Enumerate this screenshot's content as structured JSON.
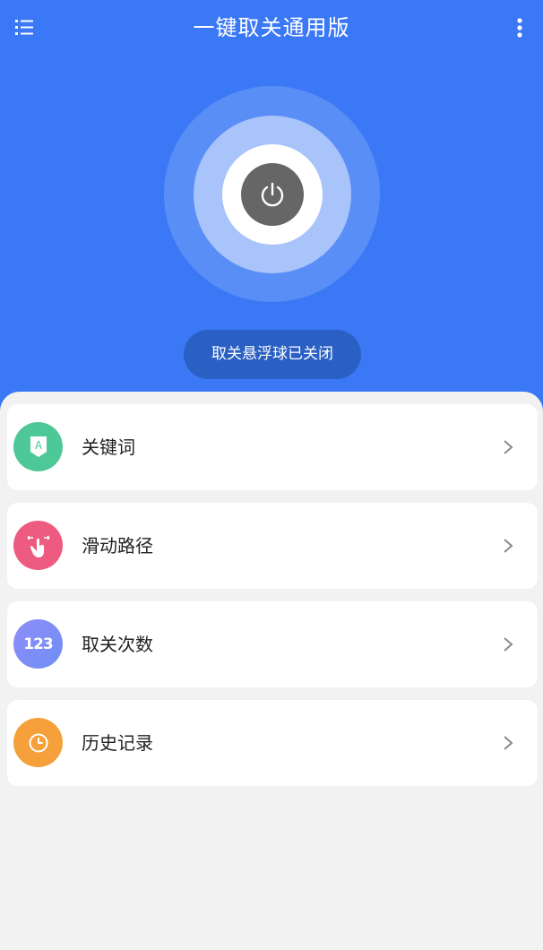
{
  "header": {
    "title": "一键取关通用版",
    "menu_icon": "list-menu-icon",
    "more_icon": "more-vertical-icon"
  },
  "power": {
    "icon": "power-icon",
    "status_text": "取关悬浮球已关闭"
  },
  "colors": {
    "primary": "#3a78f6",
    "pill": "#2a5fc3",
    "power_button": "#666666",
    "background": "#f2f2f2"
  },
  "menu": {
    "items": [
      {
        "label": "关键词",
        "icon": "keyword-tag-icon",
        "icon_text": "A",
        "color": "#4fc897"
      },
      {
        "label": "滑动路径",
        "icon": "swipe-gesture-icon",
        "color": "#ee5b80"
      },
      {
        "label": "取关次数",
        "icon": "count-123-icon",
        "icon_text": "123",
        "color": "#7d86f6"
      },
      {
        "label": "历史记录",
        "icon": "clock-history-icon",
        "color": "#f5a03a"
      }
    ]
  }
}
